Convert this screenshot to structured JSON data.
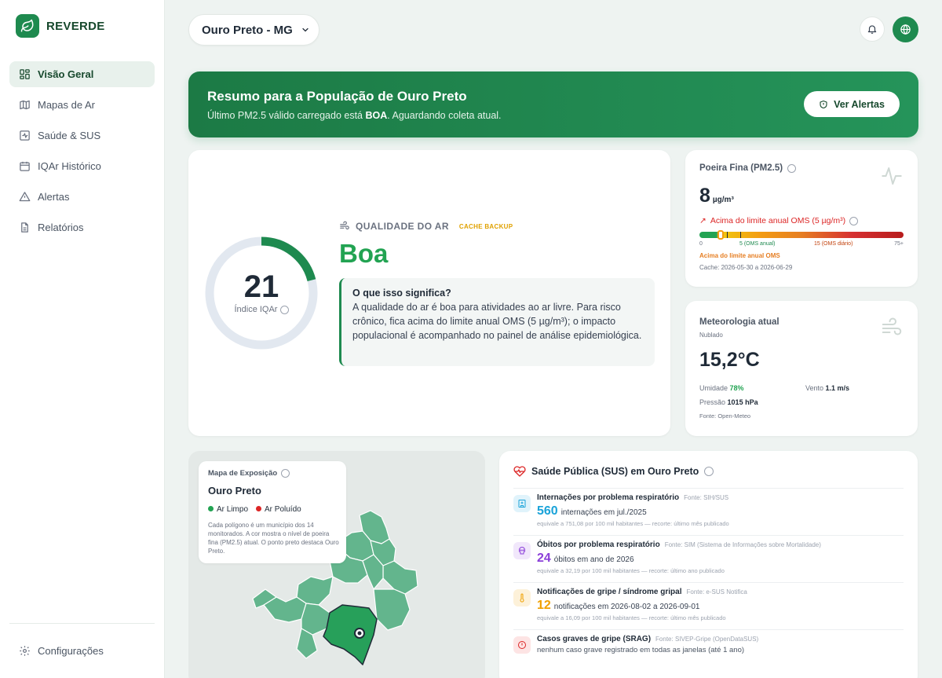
{
  "app": {
    "name": "REVERDE"
  },
  "sidebar": {
    "items": [
      {
        "label": "Visão Geral"
      },
      {
        "label": "Mapas de Ar"
      },
      {
        "label": "Saúde & SUS"
      },
      {
        "label": "IQAr Histórico"
      },
      {
        "label": "Alertas"
      },
      {
        "label": "Relatórios"
      }
    ],
    "settings_label": "Configurações"
  },
  "header": {
    "city": "Ouro Preto - MG"
  },
  "banner": {
    "title": "Resumo para a População de Ouro Preto",
    "subtitle_pre": "Último PM2.5 válido carregado está ",
    "subtitle_strong": "BOA",
    "subtitle_post": ". Aguardando coleta atual.",
    "button_label": "Ver Alertas"
  },
  "air_quality": {
    "value": "21",
    "value_fraction": 0.21,
    "value_label": "Índice IQAr",
    "section_label": "QUALIDADE DO AR",
    "tag": "CACHE BACKUP",
    "status": "Boa",
    "status_color": "#22a352",
    "meaning_title": "O que isso significa?",
    "meaning_text": "A qualidade do ar é boa para atividades ao ar livre. Para risco crônico, fica acima do limite anual OMS (5 µg/m³); o impacto populacional é acompanhado no painel de análise epidemiológica."
  },
  "pm25": {
    "title": "Poeira Fina (PM2.5)",
    "value": "8",
    "unit": "µg/m³",
    "alert": "Acima do limite anual OMS (5 µg/m³)",
    "scale": {
      "min": "0",
      "annual": "5 (OMS anual)",
      "daily": "15 (OMS diário)",
      "max": "75+"
    },
    "note": "Acima do limite anual OMS",
    "cache": "Cache: 2026-05-30 a 2026-06-29"
  },
  "meteo": {
    "title": "Meteorologia atual",
    "condition": "Nublado",
    "temperature": "15,2°C",
    "humidity_label": "Umidade",
    "humidity_value": "78%",
    "wind_label": "Vento",
    "wind_value": "1.1 m/s",
    "pressure_label": "Pressão",
    "pressure_value": "1015 hPa",
    "source": "Fonte: Open-Meteo"
  },
  "map": {
    "title": "Mapa de Exposição",
    "city": "Ouro Preto",
    "legend_clean": "Ar Limpo",
    "legend_polluted": "Ar Poluído",
    "clean_color": "#22a352",
    "polluted_color": "#dc2626",
    "description": "Cada polígono é um município dos 14 monitorados. A cor mostra o nível de poeira fina (PM2.5) atual. O ponto preto destaca Ouro Preto."
  },
  "health": {
    "title": "Saúde Pública (SUS) em Ouro Preto",
    "items": [
      {
        "name": "Internações por problema respiratório",
        "source": "Fonte: SIH/SUS",
        "value": "560",
        "value_text": "internações em jul./2025",
        "note": "equivale a 751,08 por 100 mil habitantes — recorte: último mês publicado",
        "color": "#1aa3d9"
      },
      {
        "name": "Óbitos por problema respiratório",
        "source": "Fonte: SIM (Sistema de Informações sobre Mortalidade)",
        "value": "24",
        "value_text": "óbitos em ano de 2026",
        "note": "equivale a 32,19 por 100 mil habitantes — recorte: último ano publicado",
        "color": "#8b3fd9"
      },
      {
        "name": "Notificações de gripe / síndrome gripal",
        "source": "Fonte: e-SUS Notifica",
        "value": "12",
        "value_text": "notificações em 2026-08-02 a 2026-09-01",
        "note": "equivale a 16,09 por 100 mil habitantes — recorte: último mês publicado",
        "color": "#f0a000"
      },
      {
        "name": "Casos graves de gripe (SRAG)",
        "source": "Fonte: SIVEP-Gripe (OpenDataSUS)",
        "text": "nenhum caso grave registrado em todas as janelas (até 1 ano)",
        "color": "#dc2626"
      }
    ]
  }
}
